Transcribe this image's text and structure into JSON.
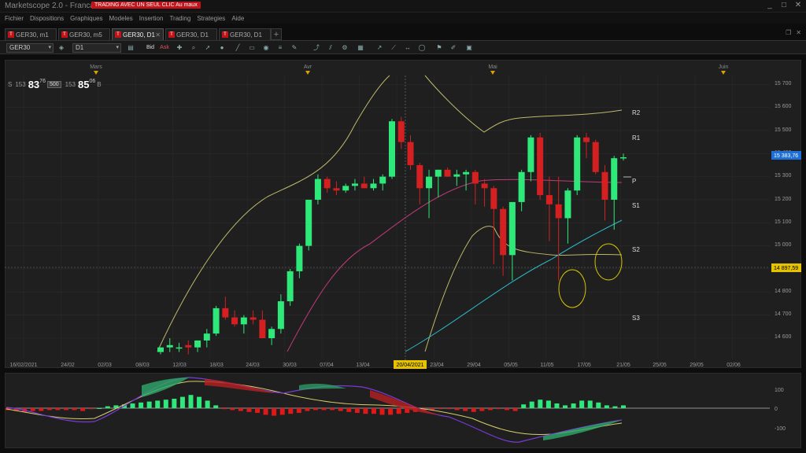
{
  "window": {
    "title": "Marketscope 2.0 - Francais",
    "controls": [
      "_",
      "□",
      "✕"
    ]
  },
  "menu": {
    "items": [
      "Fichier",
      "Dispositions",
      "Graphiques",
      "Modeles",
      "Insertion",
      "Trading",
      "Strategies",
      "Aide"
    ],
    "promo": "TRADING AVEC UN SEUL CLIC Au maux"
  },
  "tabs": [
    {
      "label": "GER30, m1",
      "active": false
    },
    {
      "label": "GER30, m5",
      "active": false
    },
    {
      "label": "GER30, D1",
      "active": true
    },
    {
      "label": "GER30, D1",
      "active": false
    },
    {
      "label": "GER30, D1",
      "active": false
    }
  ],
  "toolbar": {
    "instrument": "GER30",
    "timeframe": "D1",
    "bid_label": "Bid",
    "ask_label": "Ask"
  },
  "quote": {
    "sell_label": "S",
    "sell_prefix": "153",
    "sell_big": "83",
    "sell_sup": "76",
    "qty": "500",
    "buy_prefix": "153",
    "buy_big": "85",
    "buy_sup": "06",
    "buy_label": "B"
  },
  "chart": {
    "month_labels": [
      "Mars",
      "Avr",
      "Mai",
      "Juin"
    ],
    "x_ticks": [
      "16/02/2021",
      "24/02",
      "02/03",
      "08/03",
      "12/03",
      "18/03",
      "24/03",
      "30/03",
      "07/04",
      "13/04",
      "20/04/2021",
      "23/04",
      "29/04",
      "05/05",
      "11/05",
      "17/05",
      "21/05",
      "25/05",
      "29/05",
      "02/06"
    ],
    "y_ticks": [
      "15 700",
      "15 600",
      "15 500",
      "15 400",
      "15 300",
      "15 200",
      "15 100",
      "15 000",
      "14 900",
      "14 800",
      "14 700",
      "14 600"
    ],
    "price_tag": "15 383,76",
    "cursor_tag": "14 897,59",
    "pivots": [
      "R2",
      "R1",
      "P",
      "S1",
      "S2",
      "S3"
    ],
    "colors": {
      "up": "#2ee87a",
      "down": "#d42020",
      "bollinger": "#bdb96a",
      "ma_pink": "#c23a7a",
      "ma_cyan": "#2ab9c9",
      "price_tag": "#1e6ed8",
      "cursor_tag": "#e6c200"
    }
  },
  "indicator": {
    "y_ticks": [
      "100",
      "0",
      "-100"
    ]
  },
  "chart_data": {
    "type": "candlestick",
    "x": [
      "10/03",
      "11/03",
      "12/03",
      "15/03",
      "16/03",
      "17/03",
      "18/03",
      "19/03",
      "22/03",
      "23/03",
      "24/03",
      "25/03",
      "26/03",
      "29/03",
      "30/03",
      "31/03",
      "01/04",
      "06/04",
      "07/04",
      "08/04",
      "09/04",
      "12/04",
      "13/04",
      "14/04",
      "15/04",
      "16/04",
      "19/04",
      "20/04",
      "21/04",
      "22/04",
      "23/04",
      "26/04",
      "27/04",
      "28/04",
      "29/04",
      "30/04",
      "03/05",
      "04/05",
      "05/05",
      "06/05",
      "07/05",
      "10/05",
      "11/05",
      "12/05",
      "13/05",
      "14/05",
      "17/05",
      "18/05",
      "19/05",
      "20/05",
      "21/05"
    ],
    "open": [
      14540,
      14560,
      14560,
      14570,
      14560,
      14590,
      14620,
      14730,
      14690,
      14660,
      14690,
      14680,
      14600,
      14640,
      14760,
      14890,
      15000,
      15200,
      15290,
      15250,
      15240,
      15260,
      15270,
      15250,
      15270,
      15300,
      15540,
      15450,
      15350,
      15250,
      15300,
      15330,
      15300,
      15310,
      15320,
      15270,
      15250,
      15160,
      14960,
      15190,
      15320,
      15470,
      15220,
      15180,
      15120,
      15240,
      15470,
      15450,
      15320,
      15200,
      15380
    ],
    "high": [
      14560,
      14600,
      14580,
      14590,
      14590,
      14640,
      14740,
      14780,
      14720,
      14700,
      14720,
      14720,
      14650,
      14790,
      14900,
      15010,
      15200,
      15310,
      15300,
      15280,
      15270,
      15290,
      15300,
      15290,
      15310,
      15550,
      15560,
      15480,
      15360,
      15330,
      15330,
      15340,
      15330,
      15330,
      15330,
      15290,
      15260,
      15170,
      15190,
      15330,
      15480,
      15490,
      15300,
      15300,
      15250,
      15480,
      15490,
      15460,
      15350,
      15390,
      15400
    ],
    "low": [
      14530,
      14540,
      14540,
      14530,
      14540,
      14560,
      14610,
      14680,
      14650,
      14620,
      14660,
      14620,
      14570,
      14620,
      14740,
      14860,
      14980,
      15180,
      15230,
      15220,
      15230,
      15240,
      15250,
      15240,
      15240,
      15290,
      15420,
      15330,
      15180,
      15120,
      15210,
      15300,
      15260,
      15240,
      15180,
      15170,
      14920,
      14870,
      14850,
      15150,
      15280,
      15200,
      15020,
      14850,
      15010,
      15220,
      15380,
      15310,
      15110,
      15070,
      15370
    ],
    "close": [
      14560,
      14570,
      14560,
      14560,
      14590,
      14620,
      14730,
      14690,
      14660,
      14690,
      14680,
      14600,
      14640,
      14760,
      14890,
      15000,
      15200,
      15290,
      15250,
      15240,
      15260,
      15270,
      15250,
      15270,
      15300,
      15540,
      15450,
      15350,
      15250,
      15300,
      15330,
      15300,
      15310,
      15320,
      15270,
      15250,
      15160,
      14960,
      15190,
      15320,
      15470,
      15220,
      15180,
      15120,
      15240,
      15470,
      15450,
      15320,
      15200,
      15380,
      15384
    ]
  }
}
